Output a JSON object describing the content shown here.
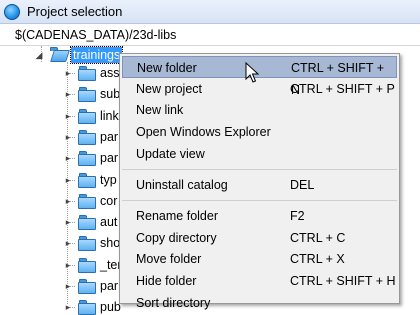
{
  "window": {
    "title": "Project selection"
  },
  "path": {
    "value": "$(CADENAS_DATA)/23d-libs"
  },
  "tree": {
    "selected": "trainings",
    "children": [
      "asse",
      "sub",
      "link",
      "par",
      "par",
      "typ",
      "cor",
      "aut",
      "sho",
      "_ter",
      "par",
      "pub"
    ]
  },
  "menu": {
    "items": [
      {
        "label": "New folder",
        "shortcut": "CTRL + SHIFT + N"
      },
      {
        "label": "New project",
        "shortcut": "CTRL + SHIFT + P"
      },
      {
        "label": "New link",
        "shortcut": ""
      },
      {
        "label": "Open Windows Explorer",
        "shortcut": ""
      },
      {
        "label": "Update view",
        "shortcut": ""
      },
      {
        "label": "Uninstall catalog",
        "shortcut": "DEL"
      },
      {
        "label": "Rename folder",
        "shortcut": "F2"
      },
      {
        "label": "Copy directory",
        "shortcut": "CTRL + C"
      },
      {
        "label": "Move folder",
        "shortcut": "CTRL + X"
      },
      {
        "label": "Hide folder",
        "shortcut": "CTRL + SHIFT + H"
      },
      {
        "label": "Sort directory",
        "shortcut": ""
      }
    ]
  },
  "icons": {
    "app": "globe-icon",
    "folder": "folder-icon",
    "open_folder": "open-folder-icon",
    "expand": "expand-arrow-icon",
    "collapse": "collapse-arrow-icon",
    "cursor": "mouse-cursor-icon"
  },
  "colors": {
    "selection": "#3399ff",
    "menu_hover": "#a6b8d3",
    "menu_bg": "#f0f0f0"
  }
}
